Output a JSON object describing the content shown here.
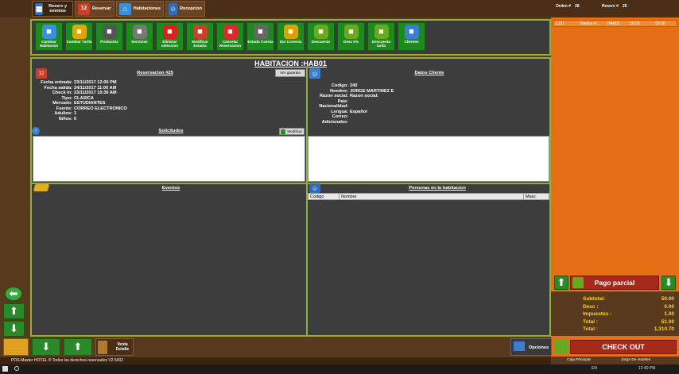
{
  "top_tabs": [
    {
      "label": "Reserv y eventos",
      "icon": "calendar-icon"
    },
    {
      "label": "Reservar",
      "icon": "calendar-12-icon"
    },
    {
      "label": "Habitaciones",
      "icon": "house-icon"
    },
    {
      "label": "Recepcion",
      "icon": "receptionist-icon"
    }
  ],
  "header_right": {
    "orden_label": "Orden #",
    "orden_value": "28",
    "reserv_label": "Reserv #",
    "reserv_value": "25"
  },
  "toolbar": [
    {
      "label": "Cambiar Habitacion",
      "icon": "room-change-icon",
      "color": "#3a8fd8"
    },
    {
      "label": "Cambiar Tarifa",
      "icon": "dollar-icon",
      "color": "#e7a400"
    },
    {
      "label": "Productos",
      "icon": "products-icon",
      "color": "#555555"
    },
    {
      "label": "Servicios",
      "icon": "wrench-icon",
      "color": "#777777"
    },
    {
      "label": "Eliminar seleccion",
      "icon": "delete-icon",
      "color": "#d9201b"
    },
    {
      "label": "Modificar Estadia",
      "icon": "calendar-12-icon",
      "color": "#c8412a"
    },
    {
      "label": "Cancelar Reservacion",
      "icon": "cancel-x-icon",
      "color": "#e0262b"
    },
    {
      "label": "Estado Cuenta",
      "icon": "printer-icon",
      "color": "#666666"
    },
    {
      "label": "Dar Cortesia",
      "icon": "courtesy-icon",
      "color": "#d8a400"
    },
    {
      "label": "Descuento",
      "icon": "discount-money-icon",
      "color": "#6aa820"
    },
    {
      "label": "Desc 0%",
      "icon": "discount-zero-icon",
      "color": "#6aa820"
    },
    {
      "label": "Descuento tarifa",
      "icon": "discount-rate-icon",
      "color": "#6aa820"
    },
    {
      "label": "Clientes",
      "icon": "client-icon",
      "color": "#3a7fd0"
    }
  ],
  "panel": {
    "title": "HABITACION :HAB01",
    "reservation_title": "Reservacion #25",
    "ver_garantia": "Ver garantia",
    "reservation_fields": [
      {
        "label": "Fecha entrada:",
        "value": "23/11/2017 12:00 PM"
      },
      {
        "label": "Fecha salida:",
        "value": "24/11/2017 11:00 AM"
      },
      {
        "label": "Check In:",
        "value": "23/11/2017 10:30 AM"
      },
      {
        "label": "Tipo:",
        "value": "CLASICA"
      },
      {
        "label": "Mercado:",
        "value": "ESTUDIANTES"
      },
      {
        "label": "Fuente:",
        "value": "CORREO ELECTRONICO"
      },
      {
        "label": "Adultos:",
        "value": "1"
      },
      {
        "label": "Niños:",
        "value": "0"
      }
    ],
    "client_title": "Datos Cliente",
    "client_fields": [
      {
        "label": "Codigo:",
        "value": "240"
      },
      {
        "label": "Nombre:",
        "value": "JORGE  MARTINEZ E"
      },
      {
        "label": "Razon social:",
        "value": "Razon social:"
      },
      {
        "label": "Pais:",
        "value": ""
      },
      {
        "label": "Nacionalidad:",
        "value": ""
      },
      {
        "label": "Lengua:",
        "value": "Español"
      },
      {
        "label": "Correo:",
        "value": ""
      },
      {
        "label": "Adicionales:",
        "value": ""
      }
    ],
    "solicitudes_title": "Solicitudes",
    "modificar_label": "Modificar",
    "eventos_title": "Eventos",
    "personas_title": "Personas en la habitacion",
    "personas_columns": [
      "Codigo",
      "Nombre",
      "Masc"
    ]
  },
  "sidebar": {
    "order_row": [
      "1.00",
      "Basica-H...",
      "HAB01",
      "50.00",
      "50.00"
    ],
    "pago_parcial": "Pago parcial",
    "totals": [
      {
        "label": "Subtotal:",
        "value": "50.00"
      },
      {
        "label": "Desc :",
        "value": "0.00"
      },
      {
        "label": "Impuestos :",
        "value": "1.00"
      },
      {
        "label": "Total :",
        "value": "51.00"
      },
      {
        "label": "Total :",
        "value": "1,310.70"
      }
    ],
    "checkout": "CHECK OUT",
    "caja": "Caja Principal",
    "user": "Jorge  De Hoteles"
  },
  "bottom": {
    "venta_detalle": "Venta Detalle",
    "opciones": "Opciones"
  },
  "status_text": "POS-Master HOTEL ® Todos los derechos reservados  V2.5432",
  "taskbar": {
    "lang": "EN",
    "time": "12:40 PM"
  }
}
